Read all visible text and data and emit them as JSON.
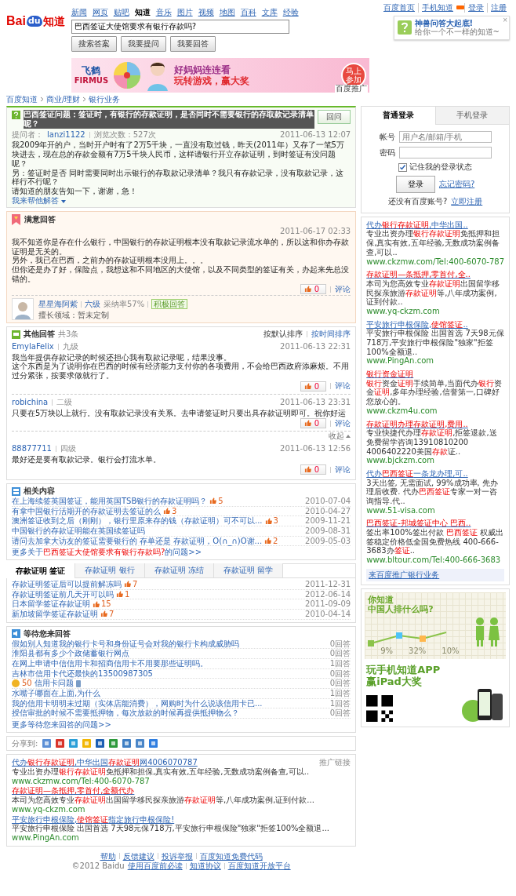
{
  "top_links": [
    "百度首页",
    "手机知道",
    "登录",
    "注册"
  ],
  "popup": {
    "title": "神兽问答大起底!",
    "subtitle": "给你一个不一样的知道~",
    "close": "×"
  },
  "logo": {
    "left": "Bai",
    "paw": "du",
    "right": "知道"
  },
  "nav": [
    {
      "label": "新闻",
      "selected": false
    },
    {
      "label": "网页",
      "selected": false
    },
    {
      "label": "贴吧",
      "selected": false
    },
    {
      "label": "知道",
      "selected": true
    },
    {
      "label": "音乐",
      "selected": false
    },
    {
      "label": "图片",
      "selected": false
    },
    {
      "label": "视频",
      "selected": false
    },
    {
      "label": "地图",
      "selected": false
    },
    {
      "label": "百科",
      "selected": false
    },
    {
      "label": "文库",
      "selected": false
    },
    {
      "label": "经验",
      "selected": false
    }
  ],
  "search": {
    "value": "巴西签证大使馆要求有银行存款吗?",
    "buttons": [
      "搜索答案",
      "我要提问",
      "我要回答"
    ]
  },
  "banner": {
    "brand": "飞鹤",
    "brand_latin": "FIRMUS",
    "headline": "好妈妈连连看",
    "subline": "玩转游戏，赢大奖",
    "cta": "马上参加",
    "sponsor": "百度推广"
  },
  "breadcrumb": [
    "百度知道",
    "商业/理财",
    "银行业务"
  ],
  "question": {
    "title": "巴西签证问题：签证时，有银行的存款证明，是否同时不需要银行的存取款记录清单呢？",
    "button": "回问",
    "asker_label": "提问者：",
    "asker": "lanzi1122",
    "views": "浏览次数：527次",
    "date": "2011-06-13 12:07",
    "body": [
      "我2009年开的户，当时开户时有了2万5千块，一直没有取过钱，昨天(2011年）又存了一笔5万块进去，现在总的存款金额有7万5千块人民币，这样请银行开立存款证明，到时签证有没问题呢？",
      "另：签证时是否 同时需要同时出示银行的存取款记录清单？我只有存款记录，没有取款记录，这样行不行呢？",
      "请知道的朋友告知一下，谢谢，急！"
    ],
    "help": "我来帮他解答"
  },
  "best_answer": {
    "title": "满意回答",
    "date": "2011-06-17 02:33",
    "body": [
      "我不知道你是存在什么银行，中国银行的存款证明根本没有取款记录流水单的，所以这和你办存款证明是无关的。",
      "另外，我已在巴西，之前办的存款证明根本没用上。。。",
      "但你还是办了好，保险点，我想这和不同地区的大使馆，以及不同类型的签证有关，办起来先总没错的。"
    ],
    "votes": "0",
    "comment": "评论",
    "user": "星星海阿紫",
    "level": "六级",
    "rate": "采纳率57%",
    "badge": "积极回答",
    "specialty": "擅长领域：暂未定制"
  },
  "other_answers": {
    "title": "其他回答",
    "count": "共3条",
    "sort": [
      {
        "label": "按默认排序",
        "selected": true
      },
      {
        "label": "按时间排序",
        "selected": false
      }
    ],
    "collapse": "收起",
    "items": [
      {
        "user": "EmylaFelix",
        "level": "九级",
        "date": "2011-06-13 22:31",
        "body": [
          "我当年提供存款记录的时候还担心我有取款记录呢，结果没事。",
          "这个东西是为了说明你在巴西的时候有经济能力支付你的各项费用，不会给巴西政府添麻烦。不用过分紧张，按要求做就行了。"
        ],
        "votes": "0",
        "comment": "评论"
      },
      {
        "user": "robichina",
        "level": "二级",
        "date": "2011-06-13 23:31",
        "body": [
          "只要在5万块以上就行。没有取款记录没有关系。去申请签证时只要出具存款证明即可。祝你好运"
        ],
        "votes": "0",
        "comment": "评论"
      },
      {
        "user": "88877711",
        "level": "四级",
        "date": "2011-06-13 12:56",
        "body": [
          "最好还是要有取款记录。银行会打流水单。"
        ],
        "votes": "0",
        "comment": "评论"
      }
    ]
  },
  "related": {
    "title": "相关内容",
    "items": [
      {
        "text": "在上海续签英国签证，能用英国TSB银行的存款证明吗？",
        "votes": "5",
        "date": "2010-07-04"
      },
      {
        "text": "有拿中国银行活期开的存款证明去签证的么",
        "votes": "3",
        "date": "2010-04-27"
      },
      {
        "text": "澳洲签证收到之后（刚刚），银行里原来存的钱（存款证明）可不可以...",
        "votes": "3",
        "date": "2009-11-21"
      },
      {
        "text": "中国银行的存款证明能在英国续签证吗",
        "date": "2009-08-31"
      },
      {
        "text": "请问去加拿大访友的签证需要银行的 存单还是 存款证明，O(∩_∩)O谢...",
        "votes": "2",
        "date": "2009-05-03"
      }
    ],
    "more": "更多关于**巴西签证大使馆要求有银行存款吗?**的问题>>"
  },
  "topic_tabs": {
    "tabs": [
      {
        "label": "存款证明 签证",
        "selected": true
      },
      {
        "label": "存款证明 银行",
        "selected": false
      },
      {
        "label": "存款证明 冻结",
        "selected": false
      },
      {
        "label": "存款证明 留学",
        "selected": false
      }
    ],
    "items": [
      {
        "text": "存款证明签证后可以提前解冻吗",
        "votes": "7",
        "date": "2011-12-31"
      },
      {
        "text": "存款证明签证前几天开可以吗",
        "votes": "1",
        "date": "2012-06-14"
      },
      {
        "text": "日本留学签证存款证明",
        "votes": "15",
        "date": "2011-09-09"
      },
      {
        "text": "新加坡留学签证存款证明",
        "votes": "7",
        "date": "2010-04-14"
      }
    ]
  },
  "waiting": {
    "title": "等待您来回答",
    "items": [
      {
        "kind": "plain",
        "text": "假如别人知道我的银行卡号和身份证号会对我的银行卡构成威胁吗",
        "answers": "0回答"
      },
      {
        "kind": "plain",
        "text": "淮阳县都有多少个政储蓄银行网点",
        "answers": "0回答"
      },
      {
        "kind": "plain",
        "text": "在网上申请中信信用卡和招商信用卡不用要那些证明吗。",
        "answers": "1回答"
      },
      {
        "kind": "plain",
        "text": "吉林市信用卡代还最快的13500987305",
        "answers": "0回答"
      },
      {
        "kind": "reward",
        "reward": "50",
        "text": "信用卡问题",
        "answers": "0回答"
      },
      {
        "kind": "plain",
        "text": "水嘴子哪面在上面,为什么",
        "answers": "1回答"
      },
      {
        "kind": "plain",
        "text": "我的信用卡明明未过期（实体店能消费），网购时为什么说该信用卡已...",
        "answers": "1回答"
      },
      {
        "kind": "plain",
        "text": "授信审批的时候不需要抵押物，每次放款的时候再提供抵押物么？",
        "answers": "0回答"
      }
    ],
    "more": "更多等待您来回答的问题>>"
  },
  "share": {
    "label": "分享到:",
    "services": [
      {
        "color": "#5b8fd6"
      },
      {
        "color": "#d9342b"
      },
      {
        "color": "#2a9fd8"
      },
      {
        "color": "#f2b705"
      },
      {
        "color": "#1d5fb4"
      },
      {
        "color": "#2e9a3c"
      },
      {
        "color": "#3f7fc4"
      },
      {
        "color": "#4a86c8"
      },
      {
        "color": "#2f7ee0"
      }
    ]
  },
  "bottom_ads": {
    "label": "推广链接",
    "items": [
      {
        "title": "代办**银行存款证明**,中华出国**存款证明**网4006070787",
        "desc": "专业出资办理**银行存款证明**免抵押和担保,真实有效,五年经验,无数成功案例备查,可以..",
        "url": "www.ckzmw.com/Tel:400-6070-787"
      },
      {
        "title": "**存款证明—条抵押,零首付,全额代办**",
        "desc": "本司为您高效专业**存款证明**出国留学移民探亲旅游**存款证明**等,八年成功案例,证到付款...",
        "url": "www.yq-ckzm.com"
      },
      {
        "title": "平安旅行申根保险,**使馆签证**指定旅行申根保险!",
        "desc": "平安旅行申根保险 出国首选 7天98元保718万,平安旅行申根保险\"独家\"拒签100%全额退...",
        "url": "www.PingAn.com"
      }
    ]
  },
  "footer": {
    "links": [
      "帮助",
      "反馈建议",
      "投诉举报",
      "百度知道免费代码"
    ],
    "copyright": "©2012 Baidu",
    "links2": [
      "使用百度前必读",
      "知道协议",
      "百度知道开放平台"
    ]
  },
  "login": {
    "tabs": [
      {
        "label": "普通登录",
        "selected": true
      },
      {
        "label": "手机登录",
        "selected": false
      }
    ],
    "account_label": "帐号",
    "account_placeholder": "用户名/邮箱/手机",
    "password_label": "密码",
    "remember": {
      "label": "记住我的登录状态",
      "checked": true
    },
    "button": "登录",
    "forgot": "忘记密码?",
    "register_text": "还没有百度账号?",
    "register": "立即注册"
  },
  "side_ads": {
    "items": [
      {
        "title": "代办**银行存款证明**,中华出国..",
        "desc": "专业出资办理**银行存款证明**免抵押和担保,真实有效,五年经验,无数成功案例备查,可以..",
        "url": "www.ckzmw.com/Tel:400-6070-787"
      },
      {
        "title": "**存款证明—条抵押,零首付,全..**",
        "desc": "本司为您高效专业**存款证明**出国留学移民探亲旅游**存款证明**等,八年成功案例,证到付款..",
        "url": "www.yq-ckzm.com"
      },
      {
        "title": "平安旅行申根保险,**使馆签证**..",
        "desc": "平安旅行申根保险 出国首选 7天98元保718万,平安旅行申根保险\"独家\"拒签100%全额退..",
        "url": "www.PingAn.com"
      },
      {
        "title": "**银行资金证明**",
        "desc": "**银行**资金**证明**手续简单,当面代办**银行**资金**证明**,多年办理经验,信誉第一,口碑好您放心的。",
        "url": "www.ckzm4u.com"
      },
      {
        "title": "**存款证明办理存款证明,费用..**",
        "desc": "专业快捷代办理**存款证明**,拒签退款,送免费留学咨询13910810200 4006402220美国**存款**证..",
        "url": "www.bjckzm.com"
      },
      {
        "title": "代办**巴西签证**一条龙办理,可..",
        "desc": "3天出签, 无需面试, 99%成功率, 先办理后收费. 代办**巴西签证**专家一对一咨询指导.代..",
        "url": "www.51-visa.com"
      },
      {
        "title": "**巴西签证-邦城签证中心 巴西..**",
        "desc": "签出率100%签出付款 **巴西签证** 权威出签稳定价格低全国免费热线 400-666-3683办**签证**..",
        "url": "www.bltour.com/Tel:400-666-3683"
      }
    ],
    "more": "来百度推广银行业务"
  },
  "promo_survey": {
    "headline": "你知道",
    "subline": "中国人排什么吗?",
    "stats": [
      "9%",
      "32%",
      "10%"
    ]
  },
  "promo_app": {
    "headline": "玩手机知道APP",
    "subline": "赢iPad大奖"
  }
}
